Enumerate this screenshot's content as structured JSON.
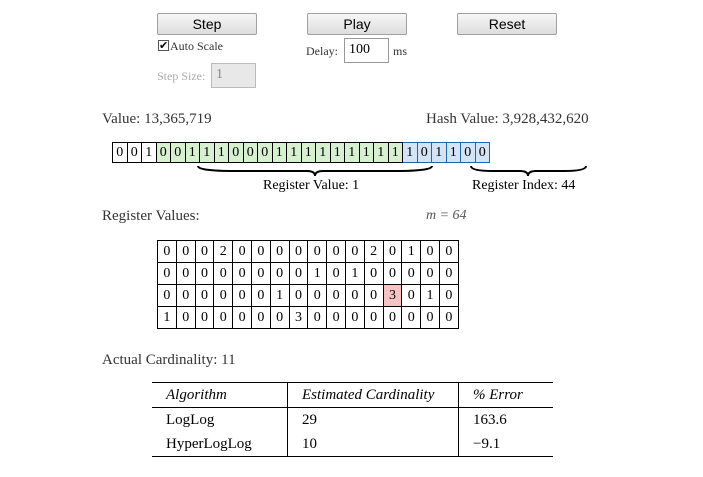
{
  "controls": {
    "step_label": "Step",
    "play_label": "Play",
    "reset_label": "Reset",
    "auto_scale_label": "Auto Scale",
    "auto_scale_checked": true,
    "step_size_label": "Step Size:",
    "step_size_value": "1",
    "delay_label": "Delay:",
    "delay_value": "100",
    "delay_unit": "ms"
  },
  "value_label": "Value: 13,365,719",
  "hash_label": "Hash Value: 3,928,432,620",
  "bits": [
    {
      "v": "0",
      "g": "none"
    },
    {
      "v": "0",
      "g": "none"
    },
    {
      "v": "1",
      "g": "none"
    },
    {
      "v": "0",
      "g": "green"
    },
    {
      "v": "0",
      "g": "green"
    },
    {
      "v": "1",
      "g": "green"
    },
    {
      "v": "1",
      "g": "green"
    },
    {
      "v": "1",
      "g": "green"
    },
    {
      "v": "0",
      "g": "green"
    },
    {
      "v": "0",
      "g": "green"
    },
    {
      "v": "0",
      "g": "green"
    },
    {
      "v": "1",
      "g": "green"
    },
    {
      "v": "1",
      "g": "green"
    },
    {
      "v": "1",
      "g": "green"
    },
    {
      "v": "1",
      "g": "green"
    },
    {
      "v": "1",
      "g": "green"
    },
    {
      "v": "1",
      "g": "green"
    },
    {
      "v": "1",
      "g": "green"
    },
    {
      "v": "1",
      "g": "green"
    },
    {
      "v": "1",
      "g": "green"
    },
    {
      "v": "1",
      "g": "blue"
    },
    {
      "v": "0",
      "g": "blue"
    },
    {
      "v": "1",
      "g": "blue"
    },
    {
      "v": "1",
      "g": "blue"
    },
    {
      "v": "0",
      "g": "blue"
    },
    {
      "v": "0",
      "g": "blue"
    }
  ],
  "register_value_label": "Register Value: 1",
  "register_index_label": "Register Index: 44",
  "register_values_label": "Register Values:",
  "m_label": "m = 64",
  "registers": [
    [
      "0",
      "0",
      "0",
      "2",
      "0",
      "0",
      "0",
      "0",
      "0",
      "0",
      "0",
      "2",
      "0",
      "1",
      "0",
      "0"
    ],
    [
      "0",
      "0",
      "0",
      "0",
      "0",
      "0",
      "0",
      "0",
      "1",
      "0",
      "1",
      "0",
      "0",
      "0",
      "0",
      "0"
    ],
    [
      "0",
      "0",
      "0",
      "0",
      "0",
      "0",
      "1",
      "0",
      "0",
      "0",
      "0",
      "0",
      "3",
      "0",
      "1",
      "0"
    ],
    [
      "1",
      "0",
      "0",
      "0",
      "0",
      "0",
      "0",
      "3",
      "0",
      "0",
      "0",
      "0",
      "0",
      "0",
      "0",
      "0"
    ]
  ],
  "highlight_register": {
    "row": 2,
    "col": 12
  },
  "actual_cardinality_label": "Actual Cardinality: 11",
  "results": {
    "headers": [
      "Algorithm",
      "Estimated Cardinality",
      "% Error"
    ],
    "rows": [
      [
        "LogLog",
        "29",
        "163.6"
      ],
      [
        "HyperLogLog",
        "10",
        "−9.1"
      ]
    ]
  },
  "colors": {
    "green_bits": "#d6f0d0",
    "blue_bits": "#d2e4f6",
    "highlight_cell": "#f7c3c3"
  }
}
